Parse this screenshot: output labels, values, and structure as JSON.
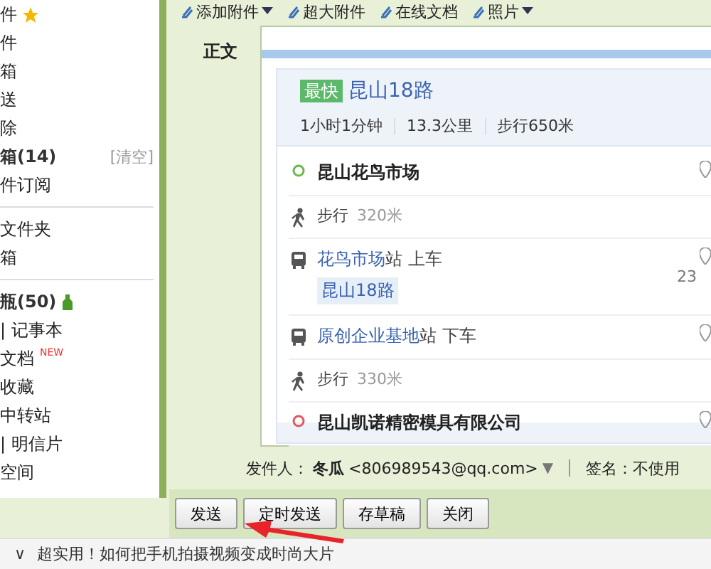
{
  "sidebar": {
    "items": [
      {
        "label": "件",
        "bold": false,
        "starred": true
      },
      {
        "label": "件",
        "bold": false
      },
      {
        "label": "箱",
        "bold": false
      },
      {
        "label": "送",
        "bold": false
      },
      {
        "label": "除",
        "bold": false
      },
      {
        "label": "箱(14)",
        "bold": true,
        "action": "[清空]"
      },
      {
        "label": "件订阅",
        "bold": false,
        "divider_after": true
      },
      {
        "label": "文件夹",
        "bold": false
      },
      {
        "label": "箱",
        "bold": false,
        "divider_after": true
      },
      {
        "label": "瓶(50)",
        "bold": true,
        "bottle": true
      },
      {
        "label": "|  记事本",
        "bold": false
      },
      {
        "label": "文档",
        "bold": false,
        "badge": "NEW"
      },
      {
        "label": "收藏",
        "bold": false
      },
      {
        "label": "中转站",
        "bold": false
      },
      {
        "label": "|  明信片",
        "bold": false
      },
      {
        "label": "空间",
        "bold": false
      }
    ]
  },
  "toolbar": [
    {
      "label": "添加附件",
      "dropdown": true
    },
    {
      "label": "超大附件",
      "dropdown": false
    },
    {
      "label": "在线文档",
      "dropdown": false
    },
    {
      "label": "照片",
      "dropdown": true
    }
  ],
  "body_label": "正文",
  "route": {
    "badge": "最快",
    "name": "昆山18路",
    "stats": [
      "1小时1分钟",
      "13.3公里",
      "步行650米"
    ],
    "steps": [
      {
        "kind": "start",
        "text": "昆山花鸟市场"
      },
      {
        "kind": "walk",
        "text": "步行",
        "distance": "320米"
      },
      {
        "kind": "board",
        "station": "花鸟市场",
        "text": "站 上车",
        "line": "昆山18路",
        "stops": "23"
      },
      {
        "kind": "alight",
        "station": "原创企业基地",
        "text": "站 下车"
      },
      {
        "kind": "walk",
        "text": "步行",
        "distance": "330米"
      },
      {
        "kind": "end",
        "text": "昆山凯诺精密模具有限公司"
      }
    ]
  },
  "sender": {
    "label": "发件人：",
    "name": "冬瓜",
    "address": "<806989543@qq.com>",
    "caret": "▼",
    "signature": "签名：不使用"
  },
  "buttons": [
    "发送",
    "定时发送",
    "存草稿",
    "关闭"
  ],
  "footer": {
    "chevron": "∨",
    "text": "超实用！如何把手机拍摄视频变成时尚大片"
  }
}
